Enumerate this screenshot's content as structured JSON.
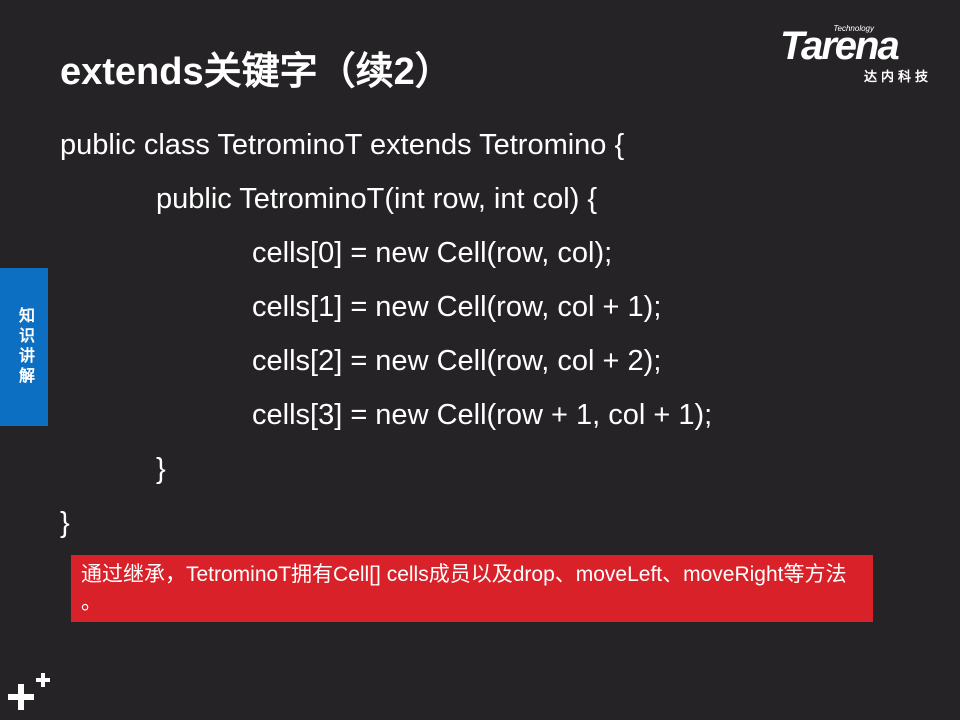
{
  "slide": {
    "title": "extends关键字（续2）",
    "logo": {
      "tagline": "Technology",
      "brand": "Tarena",
      "subtitle": "达内科技"
    },
    "side_tab": "知识讲解",
    "code_lines": [
      "public class TetrominoT extends Tetromino {",
      "public TetrominoT(int row, int col) {",
      "cells[0] = new Cell(row, col);",
      "cells[1] = new Cell(row, col + 1);",
      "cells[2] = new Cell(row, col + 2);",
      "cells[3] = new Cell(row + 1, col + 1);",
      "}",
      "}"
    ],
    "note": "通过继承，TetrominoT拥有Cell[] cells成员以及drop、moveLeft、moveRight等方法 。",
    "colors": {
      "background": "#252325",
      "side_tab": "#0c6fc1",
      "note_background": "#d9212a",
      "text": "#ffffff"
    },
    "corner_icon": "plus-plus-icon"
  }
}
